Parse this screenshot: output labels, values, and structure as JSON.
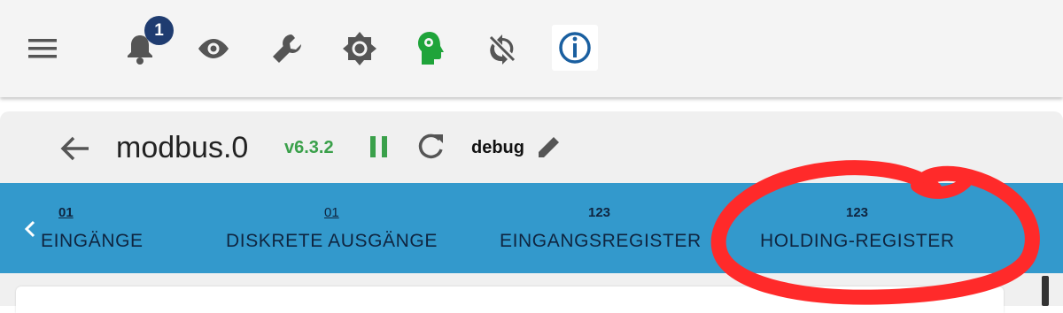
{
  "toolbar": {
    "icons": [
      "menu-icon",
      "bell-icon",
      "eye-icon",
      "wrench-icon",
      "brightness-icon",
      "head-gear-icon",
      "sync-disabled-icon",
      "iobroker-logo"
    ],
    "notification_count": "1"
  },
  "header": {
    "adapter_name": "modbus.0",
    "version": "v6.3.2",
    "log_level": "debug"
  },
  "tabs": [
    {
      "icon_text": "01",
      "label": "EINGÄNGE"
    },
    {
      "icon_text": "01",
      "label": "DISKRETE AUSGÄNGE"
    },
    {
      "icon_text": "123",
      "label": "EINGANGSREGISTER"
    },
    {
      "icon_text": "123",
      "label": "HOLDING-REGISTER"
    }
  ],
  "colors": {
    "tabbar": "#3399cc",
    "tab_text": "#0f2540",
    "version": "#3aa04a",
    "highlight": "#ff2a2a",
    "badge": "#1f3c70"
  }
}
